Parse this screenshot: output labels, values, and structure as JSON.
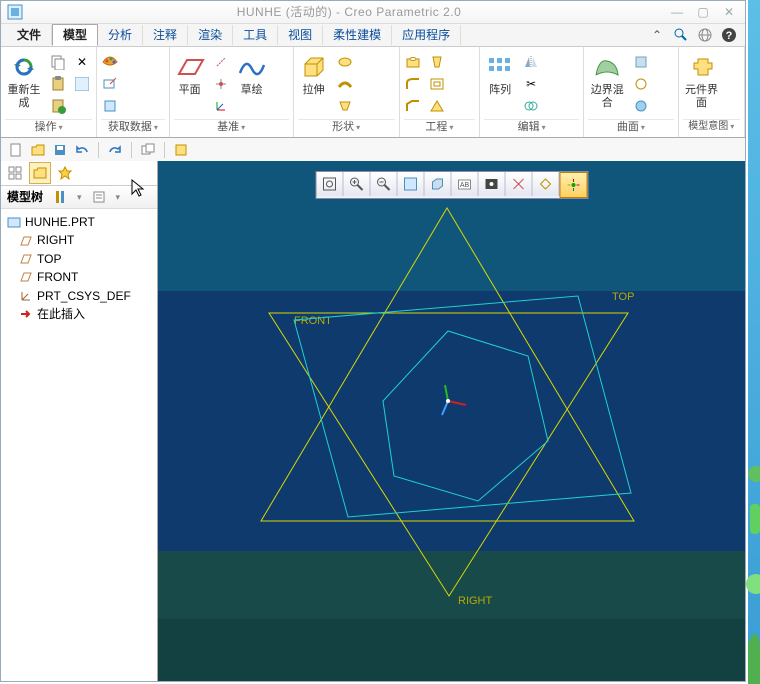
{
  "title": "HUNHE (活动的) - Creo Parametric 2.0",
  "menu": {
    "file": "文件",
    "tabs": [
      "模型",
      "分析",
      "注释",
      "渲染",
      "工具",
      "视图",
      "柔性建模",
      "应用程序"
    ]
  },
  "ribbon": {
    "regen": "重新生成",
    "plane": "平面",
    "sketch": "草绘",
    "extrude": "拉伸",
    "pattern": "阵列",
    "boundary": "边界混合",
    "component": "元件界面",
    "groups": [
      "操作",
      "获取数据",
      "基准",
      "形状",
      "工程",
      "编辑",
      "曲面",
      "模型意图"
    ]
  },
  "tree": {
    "header": "模型树",
    "root": "HUNHE.PRT",
    "items": [
      "RIGHT",
      "TOP",
      "FRONT",
      "PRT_CSYS_DEF",
      "在此插入"
    ]
  },
  "datum_labels": {
    "front": "FRONT",
    "top": "TOP",
    "right": "RIGHT"
  }
}
